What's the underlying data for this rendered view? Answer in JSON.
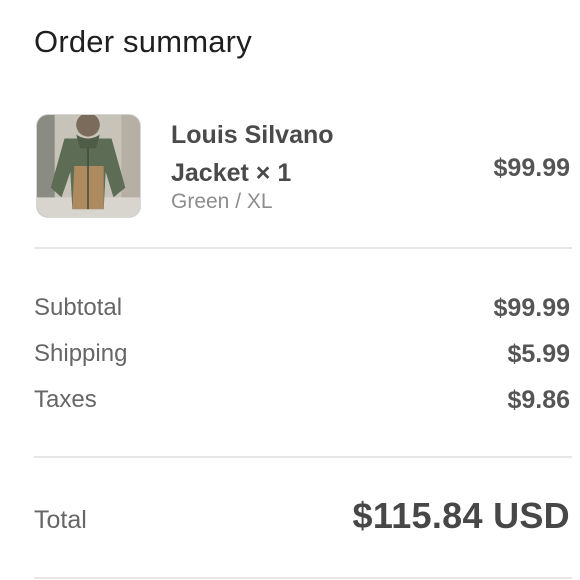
{
  "order_summary": {
    "title": "Order summary",
    "product": {
      "image_icon": "jacket-product-photo",
      "name": "Louis Silvano Jacket × 1",
      "variant": "Green / XL",
      "price": "$99.99"
    },
    "lines": [
      {
        "label": "Subtotal",
        "value": "$99.99"
      },
      {
        "label": "Shipping",
        "value": "$5.99"
      },
      {
        "label": "Taxes",
        "value": "$9.86"
      }
    ],
    "total": {
      "label": "Total",
      "value": "$115.84 USD"
    }
  }
}
